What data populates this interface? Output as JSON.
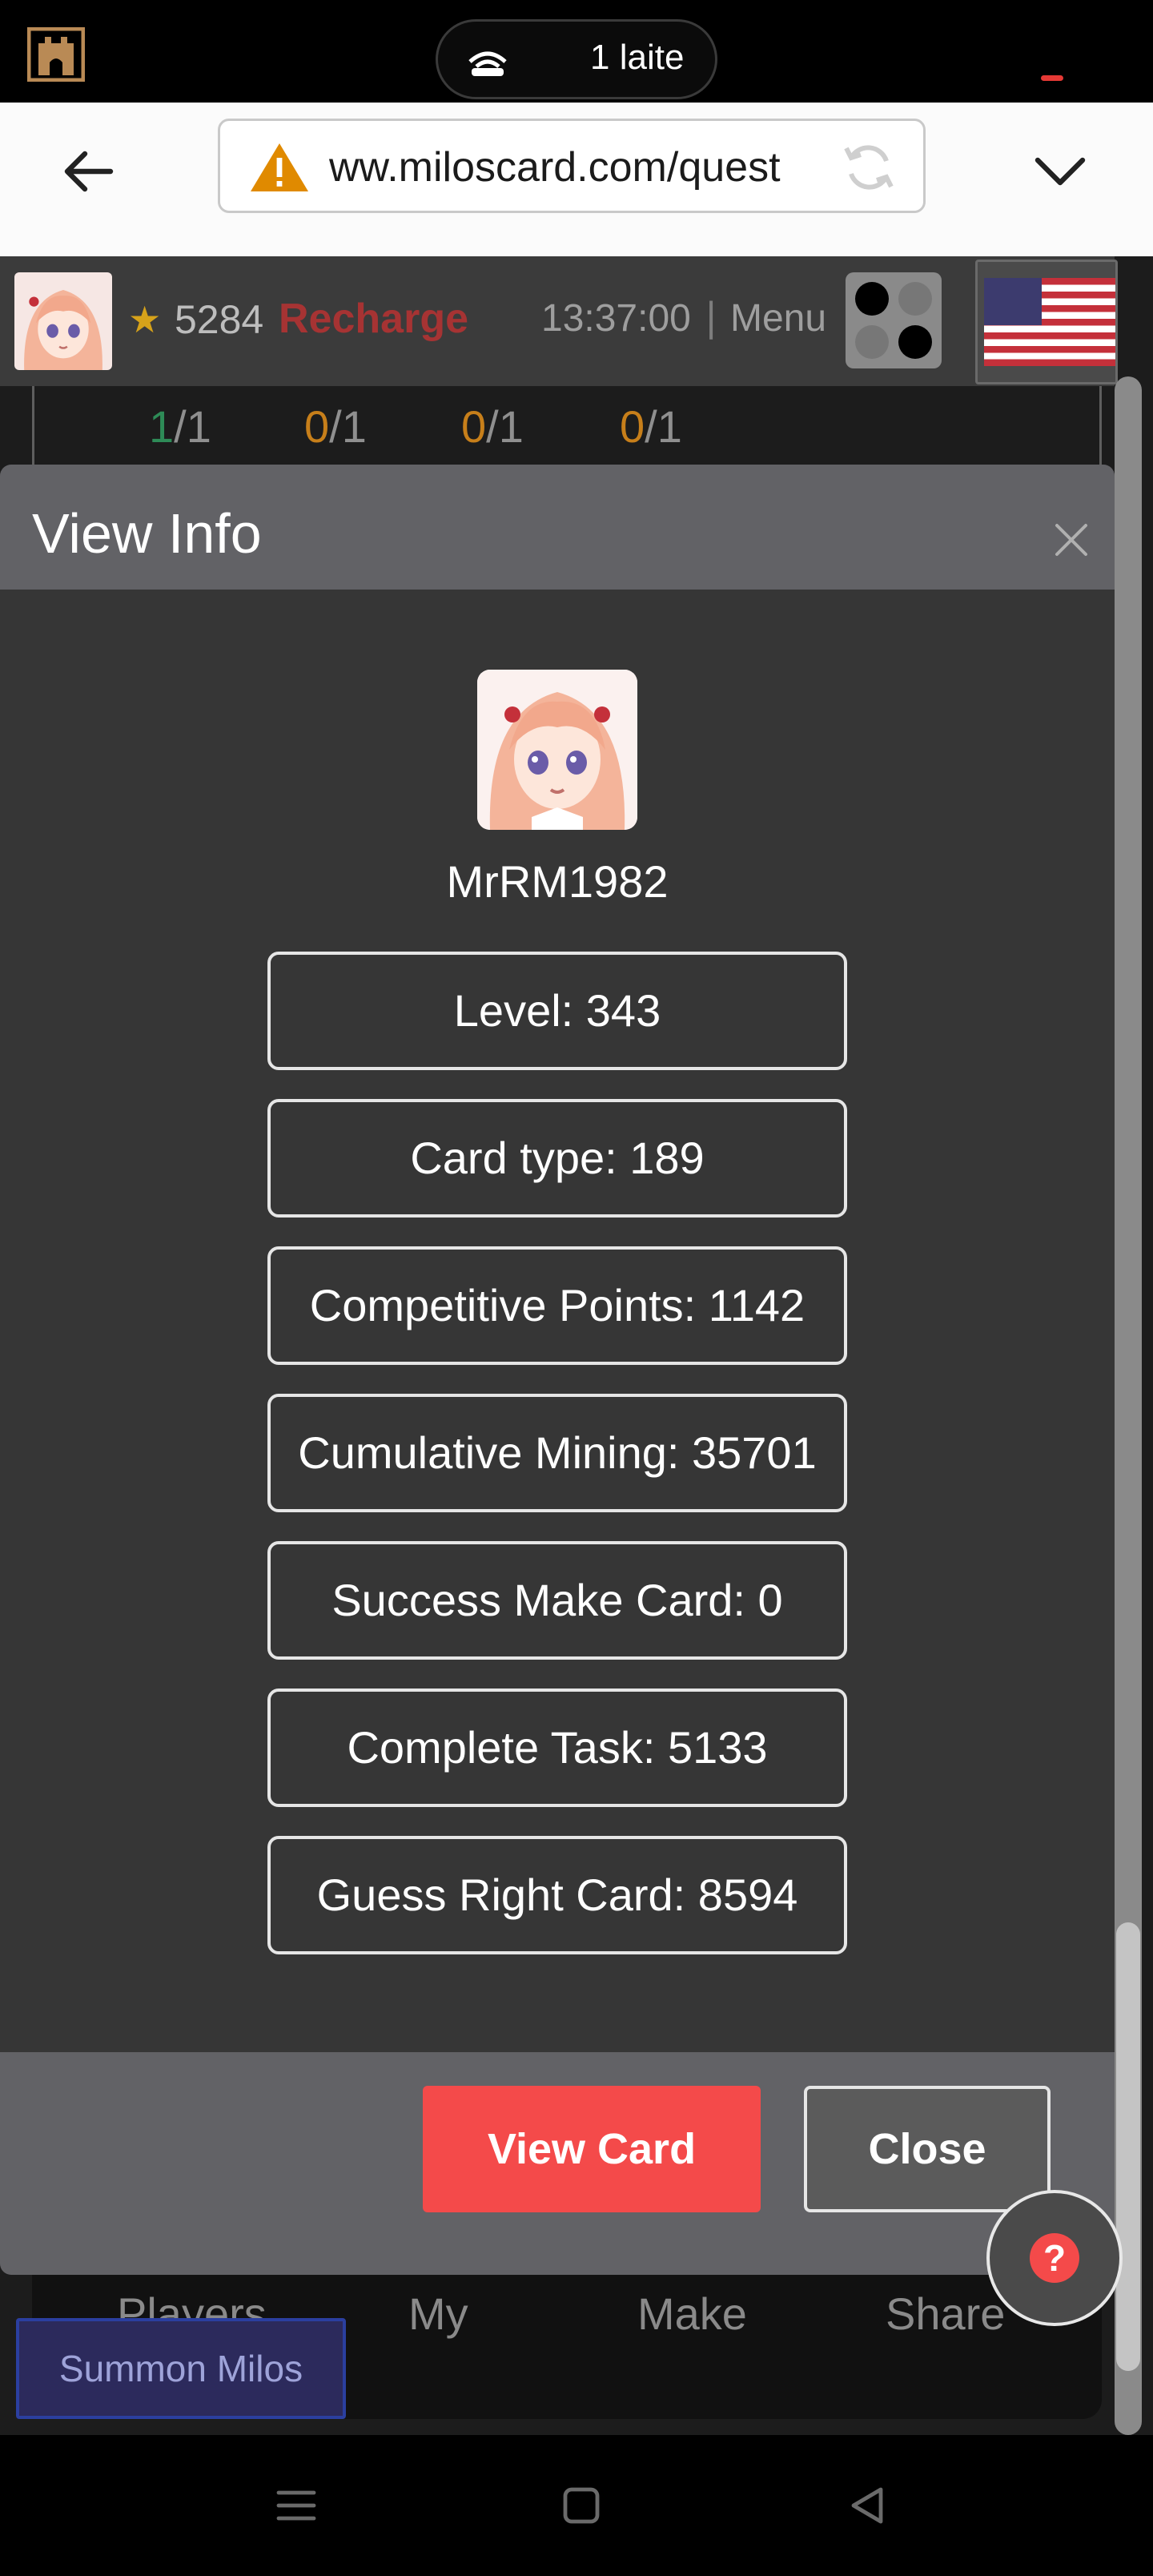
{
  "status_bar": {
    "device_pill_text": "1 laite"
  },
  "browser": {
    "url": "ww.miloscard.com/quest"
  },
  "page": {
    "coins": "5284",
    "recharge_label": "Recharge",
    "time": "13:37:00",
    "separator": "|",
    "menu_label": "Menu",
    "stats": [
      {
        "done": "1",
        "total": "/1"
      },
      {
        "done": "0",
        "total": "/1"
      },
      {
        "done": "0",
        "total": "/1"
      },
      {
        "done": "0",
        "total": "/1"
      }
    ],
    "bottom_tabs": [
      "Players",
      "My",
      "Make",
      "Share"
    ],
    "summon_label": "Summon Milos"
  },
  "modal": {
    "title": "View Info",
    "username": "MrRM1982",
    "info": [
      "Level: 343",
      "Card type: 189",
      "Competitive Points: 1142",
      "Cumulative Mining: 35701",
      "Success Make Card: 0",
      "Complete Task: 5133",
      "Guess Right Card: 8594"
    ],
    "view_card_label": "View Card",
    "close_label": "Close"
  },
  "help": {
    "symbol": "?"
  },
  "colors": {
    "accent_red": "#f44a4a",
    "modal_bg": "#363636",
    "header_bg": "#626266",
    "recharge_red": "#a63333",
    "star_gold": "#d6a21a"
  }
}
